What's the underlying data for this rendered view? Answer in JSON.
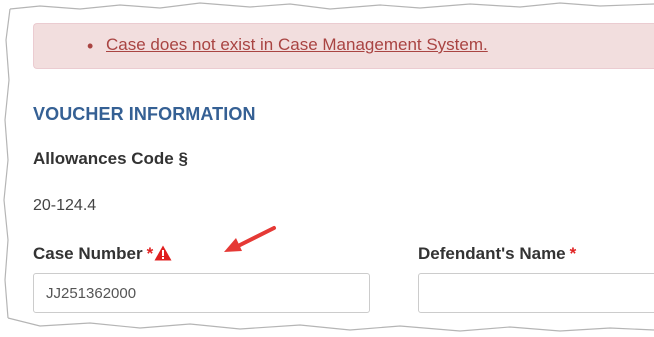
{
  "alert": {
    "message": "Case does not exist in Case Management System."
  },
  "voucher": {
    "section_title": "VOUCHER INFORMATION",
    "allowances_code_label": "Allowances Code §",
    "allowances_code_value": "20-124.4",
    "case_number_label": "Case Number",
    "case_number_value": "JJ251362000",
    "defendant_name_label": "Defendant's Name",
    "defendant_name_value": "",
    "required_marker": "*"
  },
  "colors": {
    "alert_background": "#f2dede",
    "alert_text": "#a94442",
    "section_title": "#356094",
    "required_marker": "#e02020",
    "annotation_arrow": "#e53935"
  },
  "icons": {
    "case_number_warning": "warning-triangle-icon",
    "required": "asterisk-icon"
  }
}
